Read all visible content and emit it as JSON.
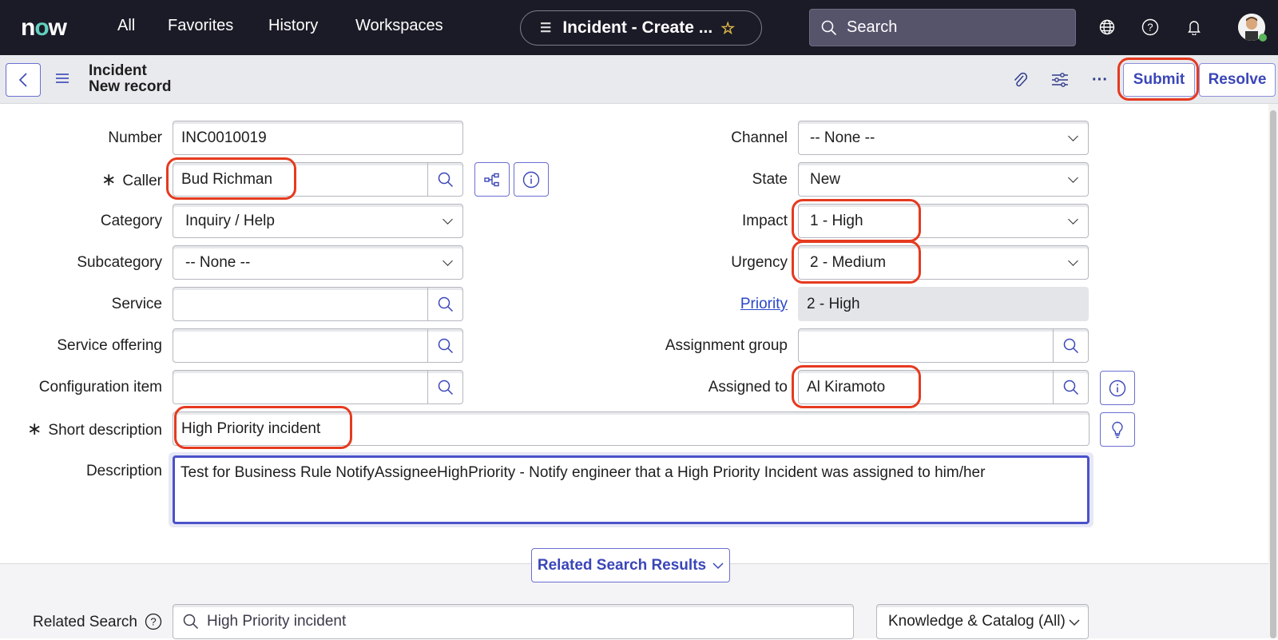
{
  "topnav": {
    "logo": "now",
    "links": [
      "All",
      "Favorites",
      "History",
      "Workspaces"
    ],
    "current_tab": "Incident - Create ...",
    "search_placeholder": "Search",
    "icons": [
      "globe-icon",
      "help-icon",
      "bell-icon"
    ],
    "user_status_color": "#5bb55b"
  },
  "header": {
    "table": "Incident",
    "record": "New record",
    "buttons": {
      "submit": "Submit",
      "resolve": "Resolve"
    },
    "icons": [
      "paperclip-icon",
      "settings-sliders-icon",
      "more-icon"
    ]
  },
  "form": {
    "left": {
      "number": {
        "label": "Number",
        "value": "INC0010019"
      },
      "caller": {
        "label": "Caller",
        "value": "Bud Richman",
        "required": true
      },
      "category": {
        "label": "Category",
        "value": "Inquiry / Help"
      },
      "subcategory": {
        "label": "Subcategory",
        "value": "-- None --"
      },
      "service": {
        "label": "Service",
        "value": ""
      },
      "service_offering": {
        "label": "Service offering",
        "value": ""
      },
      "configuration_item": {
        "label": "Configuration item",
        "value": ""
      }
    },
    "right": {
      "channel": {
        "label": "Channel",
        "value": "-- None --"
      },
      "state": {
        "label": "State",
        "value": "New"
      },
      "impact": {
        "label": "Impact",
        "value": "1 - High"
      },
      "urgency": {
        "label": "Urgency",
        "value": "2 - Medium"
      },
      "priority": {
        "label": "Priority",
        "value": "2 - High"
      },
      "assignment_group": {
        "label": "Assignment group",
        "value": ""
      },
      "assigned_to": {
        "label": "Assigned to",
        "value": "Al Kiramoto"
      }
    },
    "short_description": {
      "label": "Short description",
      "value": "High Priority incident",
      "required": true
    },
    "description": {
      "label": "Description",
      "value": "Test for Business Rule NotifyAssigneeHighPriority  - Notify engineer that a High Priority Incident was assigned to him/her"
    },
    "required_marker": "∗"
  },
  "related": {
    "toggle_label": "Related Search Results",
    "search_label": "Related Search",
    "search_value": "High Priority incident",
    "scope_value": "Knowledge & Catalog (All)"
  },
  "colors": {
    "accent": "#3a46b8",
    "highlight": "#e53a1f",
    "nav_bg": "#1a1b26"
  }
}
